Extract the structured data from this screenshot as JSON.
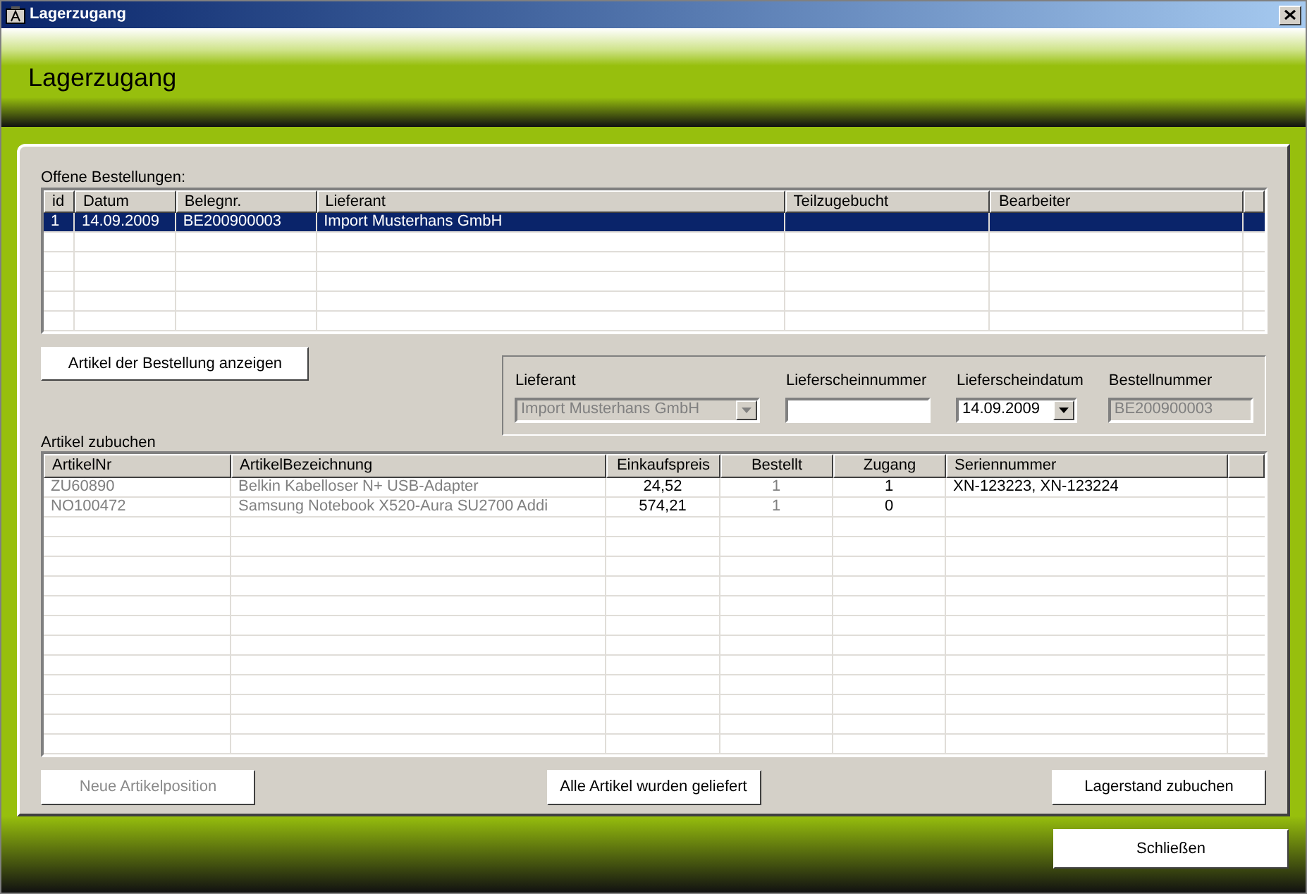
{
  "window": {
    "title": "Lagerzugang"
  },
  "header": {
    "title": "Lagerzugang"
  },
  "orders": {
    "label": "Offene Bestellungen:",
    "columns": [
      "id",
      "Datum",
      "Belegnr.",
      "Lieferant",
      "Teilzugebucht",
      "Bearbeiter"
    ],
    "rows": [
      {
        "cells": [
          "1",
          "14.09.2009",
          "BE200900003",
          "Import Musterhans GmbH",
          "",
          ""
        ],
        "selected": true
      }
    ]
  },
  "show_items_button": "Artikel der Bestellung anzeigen",
  "delivery": {
    "fields": [
      {
        "kind": "combo",
        "label": "Lieferant",
        "value": "Import Musterhans GmbH",
        "disabled": true
      },
      {
        "kind": "text",
        "label": "Lieferscheinnummer",
        "disabled": false
      },
      {
        "kind": "date",
        "label": "Lieferscheindatum",
        "value": "14.09.2009",
        "disabled": false
      },
      {
        "kind": "text",
        "label": "Bestellnummer",
        "value": "BE200900003",
        "disabled": true
      }
    ]
  },
  "items": {
    "label": "Artikel zubuchen",
    "columns": [
      {
        "title": "ArtikelNr",
        "dimmed": true
      },
      {
        "title": "ArtikelBezeichnung",
        "dimmed": true
      },
      {
        "title": "Einkaufspreis",
        "dimmed": false
      },
      {
        "title": "Bestellt",
        "dimmed": true
      },
      {
        "title": "Zugang",
        "dimmed": false
      },
      {
        "title": "Seriennummer",
        "dimmed": false
      }
    ],
    "rows": [
      [
        "ZU60890",
        "Belkin Kabelloser N+ USB-Adapter",
        "24,52",
        "1",
        "1",
        "XN-123223, XN-123224"
      ],
      [
        "NO100472",
        "Samsung Notebook X520-Aura SU2700 Addi",
        "574,21",
        "1",
        "0",
        ""
      ]
    ]
  },
  "buttons": [
    {
      "label": "Neue Artikelposition",
      "disabled": true
    },
    {
      "label": "Alle Artikel wurden geliefert",
      "disabled": false
    },
    {
      "label": "Lagerstand zubuchen",
      "disabled": false
    }
  ],
  "close_button": "Schließen"
}
